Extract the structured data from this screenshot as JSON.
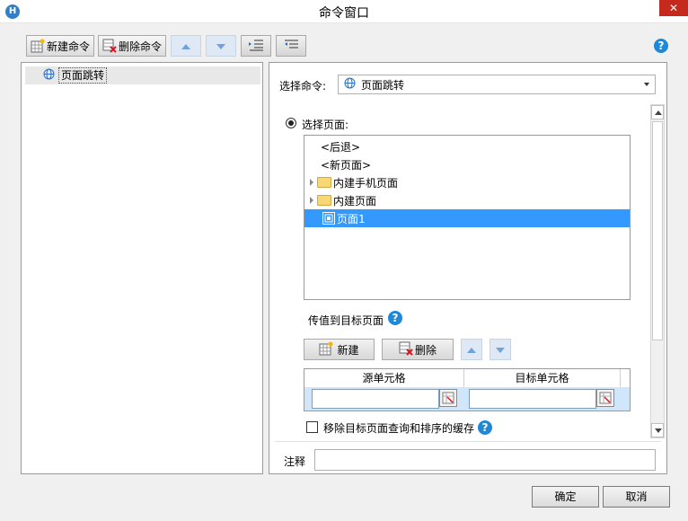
{
  "window": {
    "title": "命令窗口",
    "app_icon": "H",
    "close": "✕"
  },
  "toolbar": {
    "new_label": "新建命令",
    "delete_label": "删除命令",
    "help": "?"
  },
  "command_list": {
    "items": [
      {
        "label": "页面跳转",
        "icon": "globe-icon",
        "selected": true
      }
    ]
  },
  "detail": {
    "select_command_label": "选择命令:",
    "select_command_value": "页面跳转",
    "select_page_label": "选择页面:",
    "pages": [
      {
        "label": "<后退>",
        "type": "special"
      },
      {
        "label": "<新页面>",
        "type": "special"
      },
      {
        "label": "内建手机页面",
        "type": "folder"
      },
      {
        "label": "内建页面",
        "type": "folder"
      },
      {
        "label": "页面1",
        "type": "page",
        "selected": true
      }
    ],
    "pass_values_label": "传值到目标页面",
    "new_label": "新建",
    "delete_label": "删除",
    "grid_headers": [
      "源单元格",
      "目标单元格"
    ],
    "clear_cache_label": "移除目标页面查询和排序的缓存",
    "clear_cache_checked": false,
    "note_label": "注释",
    "note_value": ""
  },
  "footer": {
    "ok_label": "确定",
    "cancel_label": "取消"
  },
  "colors": {
    "selection": "#3399ff",
    "help_blue": "#1e88d9",
    "close_red": "#c42b1c"
  }
}
